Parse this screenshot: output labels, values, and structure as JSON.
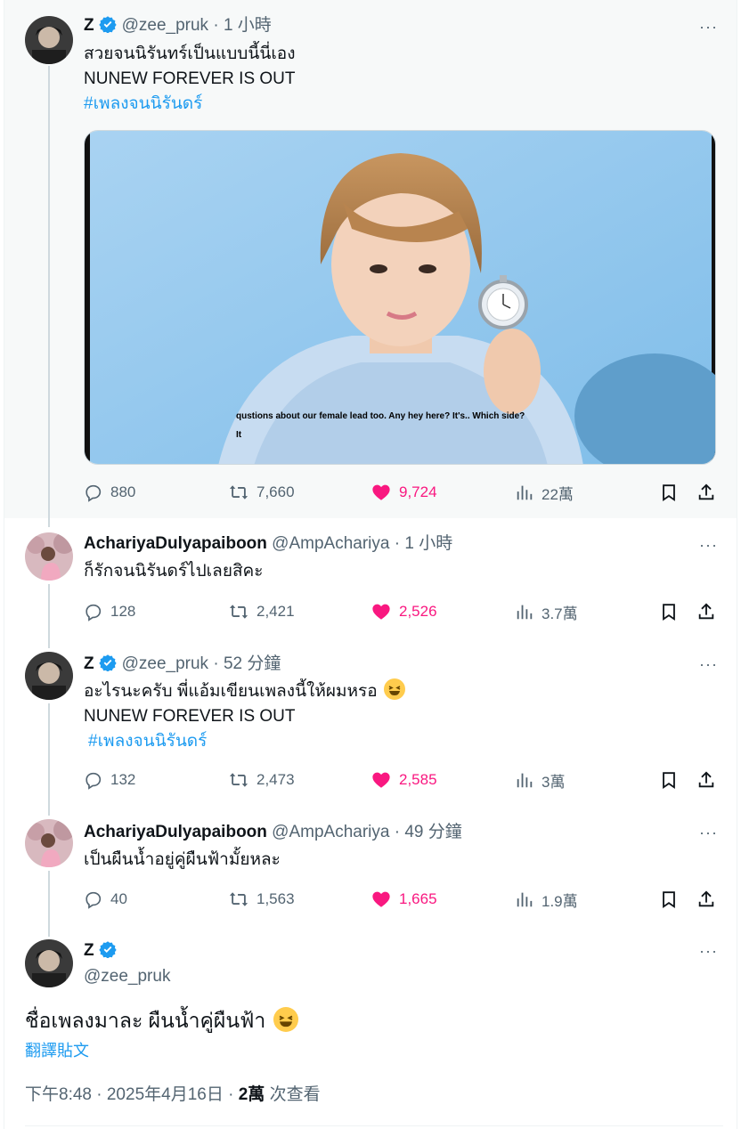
{
  "colors": {
    "accent": "#1d9bf0",
    "like": "#f91880",
    "muted": "#536471"
  },
  "tweets": [
    {
      "name": "Z",
      "handle": "@zee_pruk",
      "dot": "·",
      "time": "1 小時",
      "lines": [
        "สวยจนนิรันทร์เป็นแบบนี้นี่เอง",
        "NUNEW FOREVER IS OUT"
      ],
      "hashtag": "#เพลงจนนิรันดร์",
      "media_caption_1": "qustions about our female lead too. Any hey here? It's.. Which side?",
      "media_caption_2": "It",
      "replies": "880",
      "retweets": "7,660",
      "likes": "9,724",
      "views": "22萬"
    },
    {
      "name": "AchariyaDulyapaiboon",
      "handle": "@AmpAchariya",
      "dot": "·",
      "time": "1 小時",
      "lines": [
        "ก็รักจนนิรันดร์ไปเลยสิคะ"
      ],
      "replies": "128",
      "retweets": "2,421",
      "likes": "2,526",
      "views": "3.7萬"
    },
    {
      "name": "Z",
      "handle": "@zee_pruk",
      "dot": "·",
      "time": "52 分鐘",
      "lines": [
        "อะไรนะครับ พี่แอ้มเขียนเพลงนี้ให้ผมหรอ",
        "NUNEW FOREVER IS OUT"
      ],
      "hashtag": "#เพลงจนนิรันดร์",
      "replies": "132",
      "retweets": "2,473",
      "likes": "2,585",
      "views": "3萬"
    },
    {
      "name": "AchariyaDulyapaiboon",
      "handle": "@AmpAchariya",
      "dot": "·",
      "time": "49 分鐘",
      "lines": [
        "เป็นผืนน้ำอยู่คู่ผืนฟ้ามั้ยหละ"
      ],
      "replies": "40",
      "retweets": "1,563",
      "likes": "1,665",
      "views": "1.9萬"
    }
  ],
  "main": {
    "name": "Z",
    "handle": "@zee_pruk",
    "text": "ชื่อเพลงมาละ ผืนน้ำคู่ผืนฟ้า",
    "translate": "翻譯貼文",
    "timestamp": "下午8:48 · 2025年4月16日 · ",
    "views_count": "2萬",
    "views_label": " 次查看"
  },
  "more_label": "···"
}
